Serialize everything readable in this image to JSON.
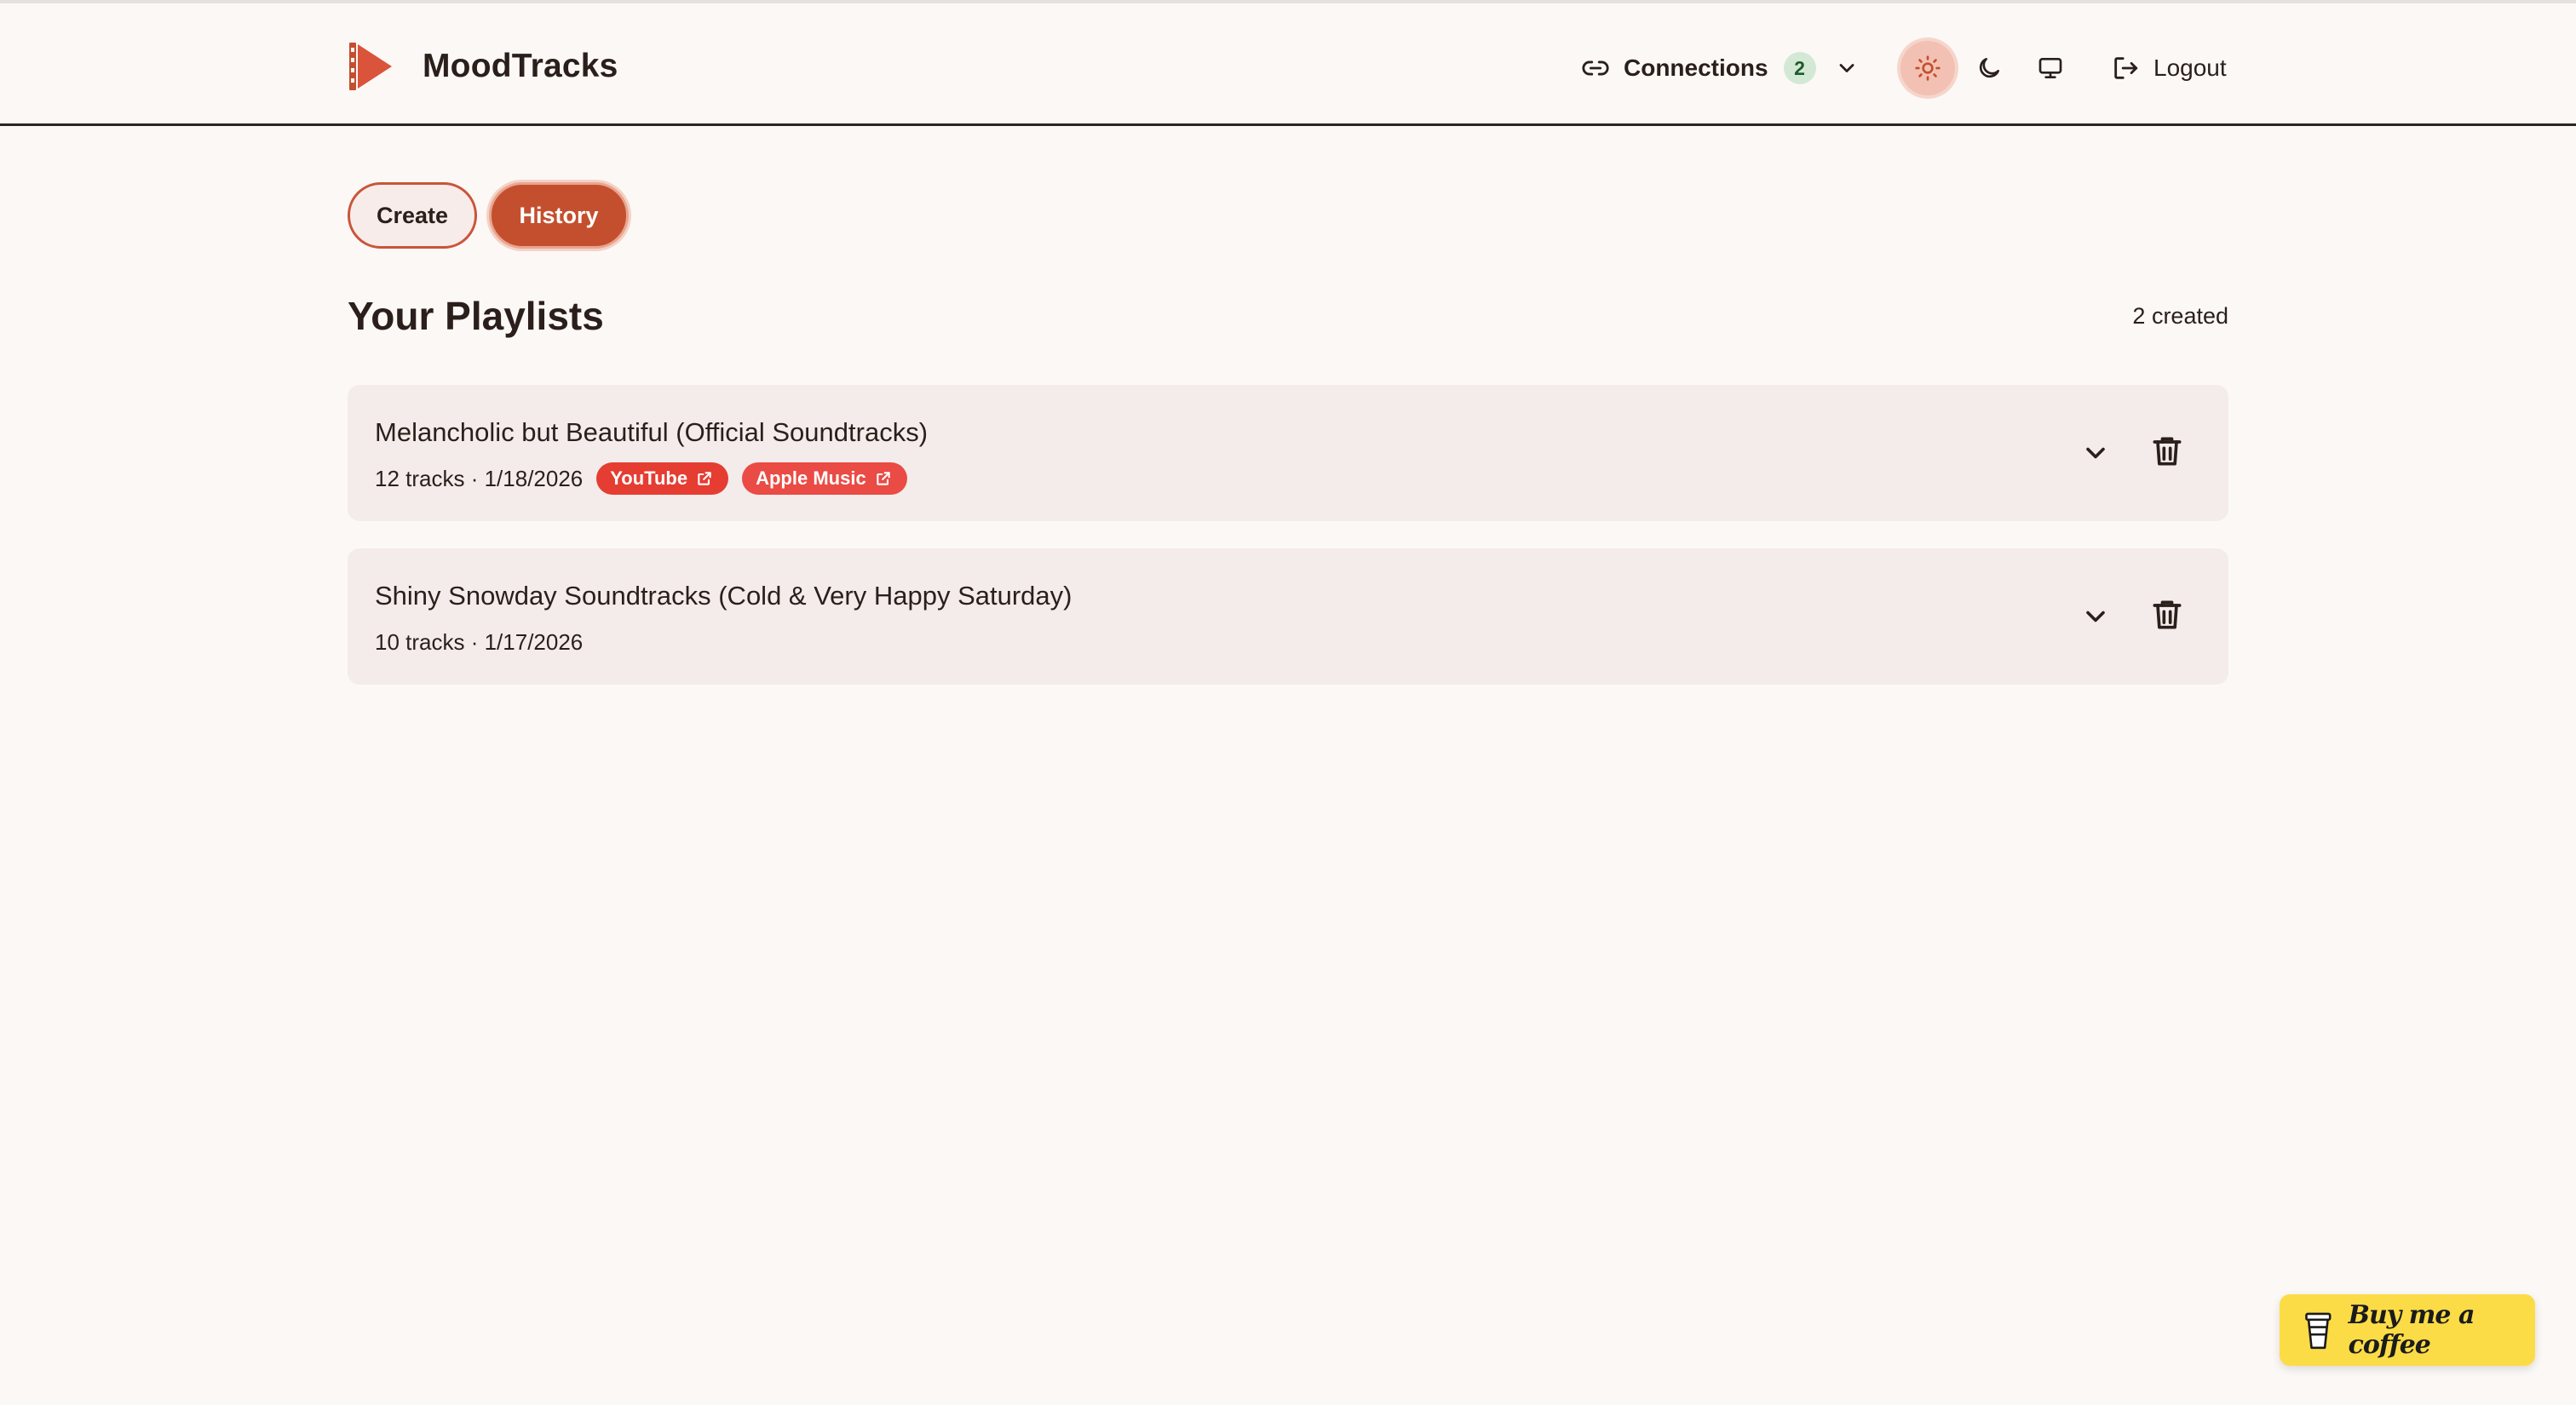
{
  "app": {
    "name": "MoodTracks",
    "brand_color": "#c44f2e"
  },
  "header": {
    "connections_label": "Connections",
    "connections_count": "2",
    "logout_label": "Logout",
    "theme_options": [
      "light-icon",
      "dark-icon",
      "system-icon"
    ],
    "active_theme": "light"
  },
  "tabs": [
    {
      "label": "Create",
      "active": false
    },
    {
      "label": "History",
      "active": true
    }
  ],
  "main": {
    "title": "Your Playlists",
    "count_text": "2 created"
  },
  "playlists": [
    {
      "title": "Melancholic but Beautiful (Official Soundtracks)",
      "meta": "12 tracks · 1/18/2026",
      "links": [
        {
          "label": "YouTube",
          "color": "#e53d32"
        },
        {
          "label": "Apple Music",
          "color": "#ea4b45"
        }
      ]
    },
    {
      "title": "Shiny Snowday Soundtracks (Cold & Very Happy Saturday)",
      "meta": "10 tracks · 1/17/2026",
      "links": []
    }
  ],
  "coffee": {
    "label": "Buy me a coffee",
    "color": "#fbdc47"
  }
}
